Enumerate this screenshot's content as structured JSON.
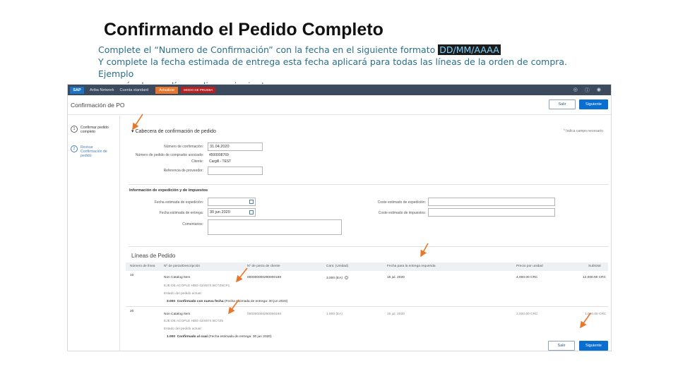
{
  "slide": {
    "title": "Confirmando el Pedido Completo",
    "line1_prefix": "Complete el “Numero de Confirmación” con la fecha en el siguiente formato",
    "line1_highlight": "DD/MM/AAAA",
    "line2": "Y complete la fecha estimada de entrega esta fecha aplicará para todas las líneas de la orden de compra. Ejemplo",
    "line3": "con más de una línea, clic en siguiente."
  },
  "topbar": {
    "logo": "SAP",
    "product": "Ariba Network",
    "account": "Cuenta standard",
    "upgrade": "Actualizar",
    "test_mode": "MODO DE PRUEBA"
  },
  "header": {
    "title": "Confirmación de PO",
    "exit_label": "Salir",
    "next_label": "Siguiente"
  },
  "steps": [
    {
      "number": "1",
      "label": "Confirmar pedido completo"
    },
    {
      "number": "2",
      "label": "Revisar Confirmación de pedido"
    }
  ],
  "form": {
    "section_title": "Cabecera de confirmación de pedido",
    "required_note": "* Indica campo necesario",
    "confirmation_number_label": "Número de confirmación:",
    "confirmation_number_value": "31.04.2020",
    "supplier_ref_label": "Número de pedido de comprador asociado:",
    "supplier_ref_value": "4500008769",
    "customer_label": "Cliente:",
    "customer_value": "Cargill - TEST",
    "provider_ref_label": "Referencia de proveedor:",
    "shipping_section": "Información de expedición y de impuestos",
    "ship_date_label": "Fecha estimada de expedición:",
    "delivery_date_label": "Fecha estimada de entrega:",
    "delivery_date_value": "30 jun 2020",
    "comments_label": "Comentarios:",
    "ship_cost_label": "Coste estimado de expedición:",
    "tax_cost_label": "Coste estimado de impuestos:"
  },
  "lines": {
    "title": "Líneas de Pedido",
    "columns": [
      "Número de línea",
      "Nº de pieza/Descripción",
      "Nº de pieza de cliente",
      "Cant. (Unidad)",
      "Fecha para la entrega requerida",
      "Precio por unidad",
      "Subtotal"
    ],
    "rows": [
      {
        "number": "10",
        "part": "Non Catalog Item",
        "customer_part": "000000000290000188",
        "qty": "3.000 (EA)",
        "date": "15 jul. 2020",
        "price": "4,000.00 CRC",
        "subtotal": "12,000.00 CRC",
        "desc": "EJE DE ACOPLE HBD 43/4674 BCTZ5CP1",
        "status_label": "Estado del pedido actual:",
        "status_qty": "3.000",
        "status_text": "Confirmado con nueva fecha",
        "status_note": "(Fecha estimada de entrega: 30 jun 2020)"
      },
      {
        "number": "20",
        "part": "Non Catalog Item",
        "customer_part": "000000000290000198",
        "qty": "1.000 (EA)",
        "date": "15 jul. 2020",
        "price": "1,000.00 CRC",
        "subtotal": "1,000.00 CRC",
        "desc": "EJE DE ACOPLE HBD 43/4674 BCTZ5",
        "status_label": "Estado del pedido actual:",
        "status_qty": "1.000",
        "status_text": "Confirmado al cual",
        "status_note": "(Fecha estimada de entrega: 30 jun 2020)"
      }
    ]
  },
  "footer": {
    "exit_label": "Salir",
    "next_label": "Siguiente"
  },
  "colors": {
    "accent": "#0a6ed1",
    "arrow": "#e8772b",
    "topbar": "#3b4a5c"
  }
}
